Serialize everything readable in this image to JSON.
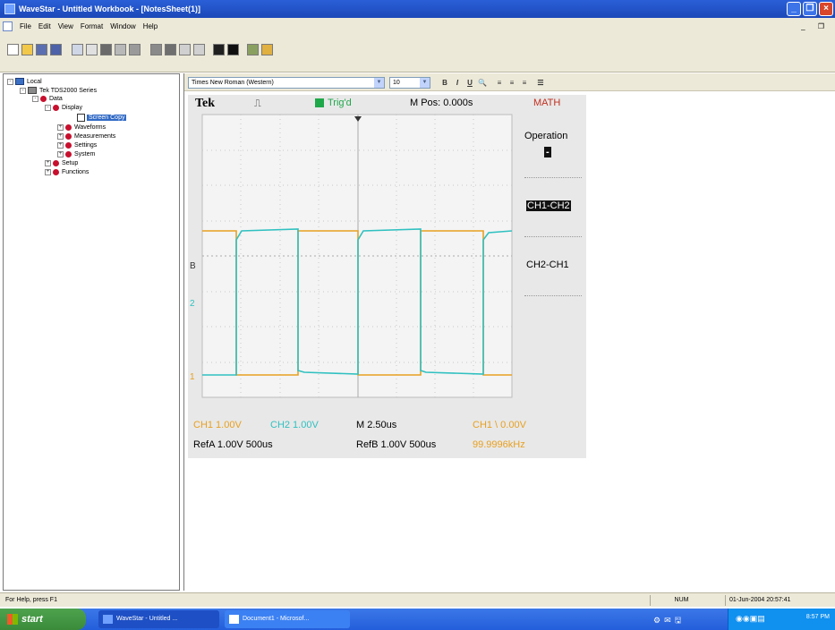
{
  "window": {
    "title": "WaveStar - Untitled Workbook - [NotesSheet(1)]",
    "controls": [
      "minimize",
      "restore",
      "close"
    ]
  },
  "menu": [
    "File",
    "Edit",
    "View",
    "Format",
    "Window",
    "Help"
  ],
  "tree": {
    "items": [
      {
        "label": "Local",
        "icon": "computer-icon",
        "expander": "-"
      },
      {
        "label": "Tek TDS2000 Series",
        "icon": "oscilloscope-icon",
        "expander": "-"
      },
      {
        "label": "Data",
        "icon": "red-dot-icon",
        "expander": "-"
      },
      {
        "label": "Display",
        "icon": "red-dot-icon",
        "expander": "-"
      },
      {
        "label": "Screen Copy",
        "icon": "screenshot-icon",
        "expander": ""
      },
      {
        "label": "Waveforms",
        "icon": "red-dot-icon",
        "expander": "+"
      },
      {
        "label": "Measurements",
        "icon": "red-dot-icon",
        "expander": "+"
      },
      {
        "label": "Settings",
        "icon": "red-dot-icon",
        "expander": "+"
      },
      {
        "label": "System",
        "icon": "red-dot-icon",
        "expander": "+"
      },
      {
        "label": "Setup",
        "icon": "red-dot-icon",
        "expander": "+"
      },
      {
        "label": "Functions",
        "icon": "red-dot-icon",
        "expander": "+"
      }
    ],
    "selected": "Screen Copy"
  },
  "format_bar": {
    "font": "Times New Roman (Western)",
    "size": "10",
    "buttons": [
      "B",
      "I",
      "U",
      "find",
      "align-left",
      "align-center",
      "align-right",
      "bullets"
    ]
  },
  "scope": {
    "brand": "Tek",
    "trigger_state": "Trig'd",
    "position": "M Pos: 0.000s",
    "menu_title": "MATH",
    "operation_label": "Operation",
    "operation_value": "-",
    "options": [
      "CH1-CH2",
      "CH2-CH1"
    ],
    "markers": {
      "b": "B",
      "ch2": "2",
      "ch1": "1"
    },
    "ch1_scale": "CH1  1.00V",
    "ch2_scale": "CH2  1.00V",
    "timebase": "M 2.50us",
    "trigger": "CH1 \\ 0.00V",
    "refa": "RefA 1.00V 500us",
    "refb": "RefB 1.00V 500us",
    "frequency": "99.9996kHz",
    "colors": {
      "ch1": "#e8a020",
      "ch2": "#30c0c0",
      "math": "#c03020",
      "bg": "#e8e8e8"
    }
  },
  "status": {
    "help": "For Help, press F1",
    "num": "NUM",
    "datetime": "01-Jun-2004 20:57:41"
  },
  "taskbar": {
    "start": "start",
    "tasks": [
      "WaveStar - Untitled ...",
      "Document1 - Microsof..."
    ],
    "clock": "8:57 PM"
  }
}
